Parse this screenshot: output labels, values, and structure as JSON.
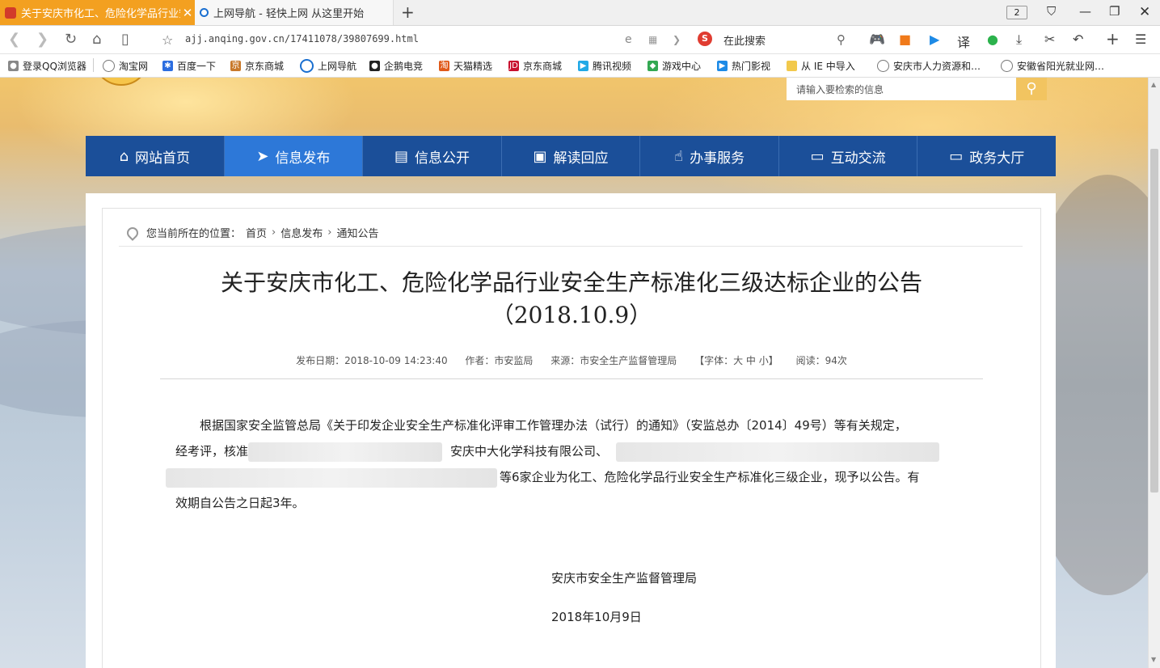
{
  "browser": {
    "tabs": [
      {
        "title": "关于安庆市化工、危险化学品行业安",
        "active": true
      },
      {
        "title": "上网导航 - 轻快上网 从这里开始",
        "active": false
      }
    ],
    "tab_count": "2",
    "url": "ajj.anqing.gov.cn/17411078/39807699.html",
    "search_placeholder": "在此搜索",
    "translate_label": "译",
    "bookmarks": [
      {
        "label": "登录QQ浏览器",
        "icon": "user-icon"
      },
      {
        "label": "淘宝网",
        "icon": "globe-icon"
      },
      {
        "label": "百度一下",
        "icon": "baidu-paw-icon"
      },
      {
        "label": "京东商城",
        "icon": "jd-icon"
      },
      {
        "label": "上网导航",
        "icon": "ie-icon"
      },
      {
        "label": "企鹅电竞",
        "icon": "penguin-icon"
      },
      {
        "label": "天猫精选",
        "icon": "tmall-icon"
      },
      {
        "label": "京东商城",
        "icon": "jd-logo-icon"
      },
      {
        "label": "腾讯视频",
        "icon": "video-play-icon"
      },
      {
        "label": "游戏中心",
        "icon": "gamepad-icon"
      },
      {
        "label": "热门影视",
        "icon": "film-play-icon"
      },
      {
        "label": "从 IE 中导入",
        "icon": "folder-icon"
      },
      {
        "label": "安庆市人力资源和…",
        "icon": "globe-icon"
      },
      {
        "label": "安徽省阳光就业网…",
        "icon": "globe-icon"
      }
    ]
  },
  "site": {
    "search_placeholder": "请输入要检索的信息",
    "nav": [
      {
        "label": "网站首页",
        "icon": "home-icon",
        "active": false
      },
      {
        "label": "信息发布",
        "icon": "send-icon",
        "active": true
      },
      {
        "label": "信息公开",
        "icon": "book-icon",
        "active": false
      },
      {
        "label": "解读回应",
        "icon": "document-icon",
        "active": false
      },
      {
        "label": "办事服务",
        "icon": "service-hand-icon",
        "active": false
      },
      {
        "label": "互动交流",
        "icon": "chat-icon",
        "active": false
      },
      {
        "label": "政务大厅",
        "icon": "monitor-icon",
        "active": false
      }
    ]
  },
  "breadcrumb": {
    "prefix": "您当前所在的位置：",
    "items": [
      "首页",
      "信息发布",
      "通知公告"
    ]
  },
  "article": {
    "title_line1": "关于安庆市化工、危险化学品行业安全生产标准化三级达标企业的公告",
    "title_line2": "（2018.10.9）",
    "meta": {
      "date": "发布日期：2018-10-09 14:23:40",
      "author": "作者：市安监局",
      "source": "来源：市安全生产监督管理局",
      "font": "【字体：大 中 小】",
      "reads": "阅读：94次"
    },
    "para_1": "根据国家安全监管总局《关于印发企业安全生产标准化评审工作管理办法（试行）的通知》（安监总办〔2014〕49号）等有关规定，",
    "para_2a": "经考评，核准",
    "para_2b": "安庆中大化学科技有限公司、",
    "para_3b": "等6家企业为化工、危险化学品行业安全生产标准化三级企业，现予以公告。有",
    "para_4": "效期自公告之日起3年。",
    "signature": "安庆市安全生产监督管理局",
    "sign_date": "2018年10月9日"
  }
}
